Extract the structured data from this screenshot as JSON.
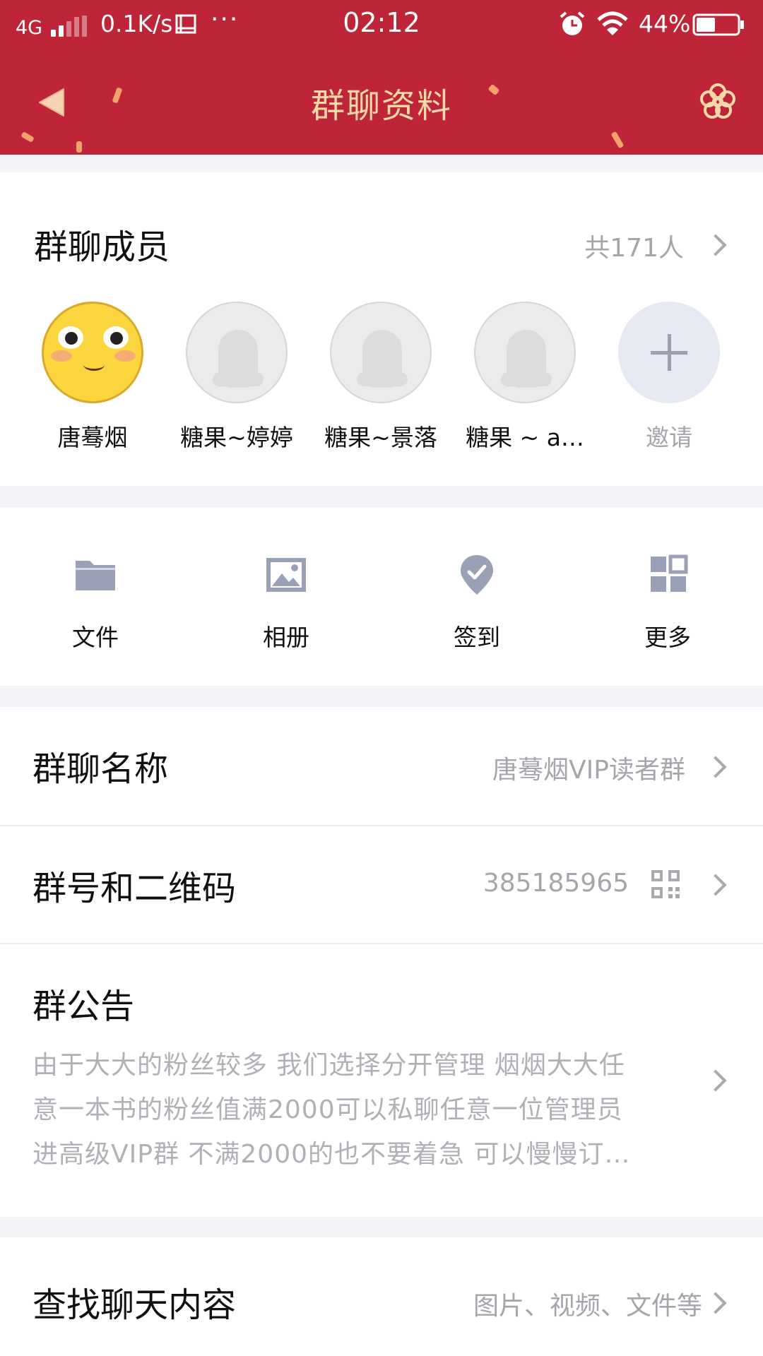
{
  "status_bar": {
    "network": "4G",
    "speed": "0.1K/s",
    "dots": "···",
    "time": "02:12",
    "battery": "44%"
  },
  "nav": {
    "title": "群聊资料",
    "back_icon": "back-arrow-icon",
    "right_icon": "flower-icon"
  },
  "members": {
    "title": "群聊成员",
    "count": "共171人",
    "list": [
      {
        "name": "唐蓦烟",
        "avatar": "emoji-face"
      },
      {
        "name": "糖果~婷婷",
        "avatar": "default-penguin"
      },
      {
        "name": "糖果~景落",
        "avatar": "default-penguin"
      },
      {
        "name": "糖果 ~ a…",
        "avatar": "default-penguin"
      }
    ],
    "invite_label": "邀请"
  },
  "tools": [
    {
      "label": "文件",
      "icon": "folder-icon"
    },
    {
      "label": "相册",
      "icon": "image-icon"
    },
    {
      "label": "签到",
      "icon": "checkin-icon"
    },
    {
      "label": "更多",
      "icon": "grid-icon"
    }
  ],
  "group_name": {
    "title": "群聊名称",
    "value": "唐蓦烟VIP读者群"
  },
  "group_number": {
    "title": "群号和二维码",
    "value": "385185965"
  },
  "announcement": {
    "title": "群公告",
    "lines": [
      "由于大大的粉丝较多 我们选择分开管理 烟烟大大任",
      "意一本书的粉丝值满2000可以私聊任意一位管理员",
      "进高级VIP群 不满2000的也不要着急 可以慢慢订…"
    ]
  },
  "search_chat": {
    "title": "查找聊天内容",
    "value": "图片、视频、文件等"
  },
  "colors": {
    "header_bg": "#bf2539",
    "title_gold": "#f3d9a8",
    "icon_gray": "#9aa0b6",
    "secondary_text": "#a5a5ab"
  }
}
